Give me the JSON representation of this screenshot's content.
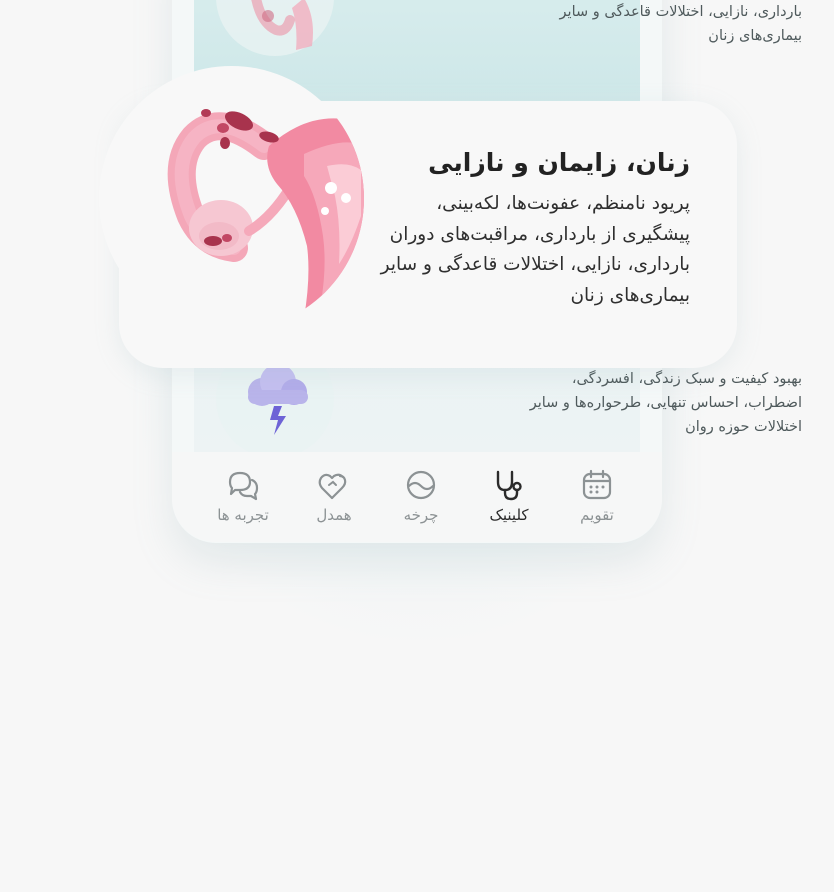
{
  "background_cards": {
    "top": {
      "lines": [
        "بارداری، نازایی، اختلالات قاعدگی و سایر",
        "بیماری‌های زنان"
      ]
    },
    "bottom": {
      "lines": [
        "بهبود کیفیت و سبک زندگی، افسردگی،",
        "اضطراب، احساس تنهایی، طرحواره‌ها و سایر",
        "اختلالات حوزه روان"
      ]
    }
  },
  "featured_card": {
    "title": "زنان، زایمان و نازایی",
    "lines": [
      "پریود نامنظم، عفونت‌ها، لکه‌بینی،",
      "پیشگیری از بارداری، مراقبت‌های دوران",
      "بارداری، نازایی، اختلالات قاعدگی و سایر",
      "بیماری‌های زنان"
    ]
  },
  "tabbar": {
    "items": [
      {
        "label": "تقویم",
        "icon": "calendar-icon",
        "active": false
      },
      {
        "label": "کلینیک",
        "icon": "stethoscope-icon",
        "active": true
      },
      {
        "label": "چرخه",
        "icon": "cycle-icon",
        "active": false
      },
      {
        "label": "همدل",
        "icon": "hearts-icon",
        "active": false
      },
      {
        "label": "تجربه ها",
        "icon": "chat-bubbles-icon",
        "active": false
      }
    ]
  },
  "colors": {
    "accent_pink": "#f28aa2",
    "dark_pink": "#a8334d",
    "cloud_purple": "#b9b4ea",
    "icon_gray": "#8c9294",
    "active_dark": "#2b2b2b"
  }
}
